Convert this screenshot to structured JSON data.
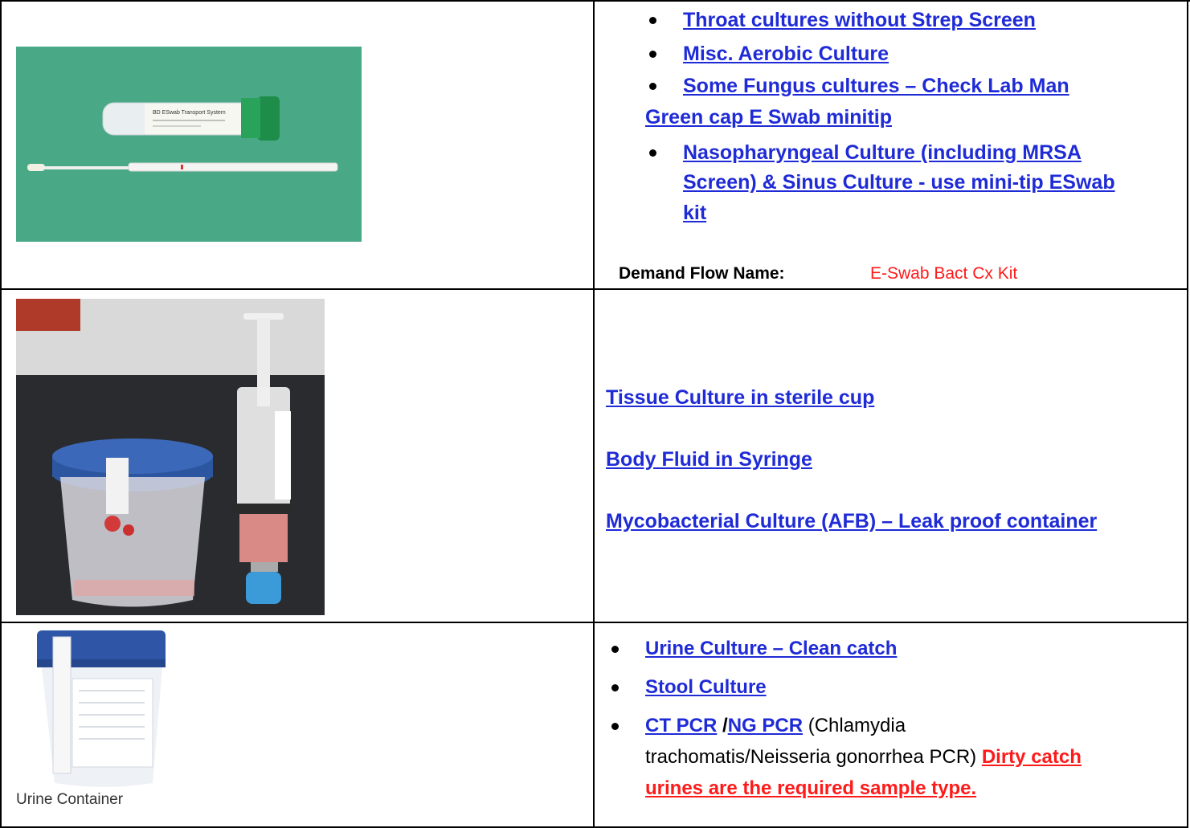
{
  "row1": {
    "links": [
      "Throat cultures without Strep Screen",
      "Misc. Aerobic Culture",
      "Some Fungus cultures – Check Lab Man",
      "Green cap E Swab minitip",
      "Nasopharyngeal Culture (including MRSA",
      "Screen) & Sinus Culture - use mini-tip ESwab",
      "kit"
    ],
    "demand_flow_label": "Demand Flow Name:",
    "demand_flow_value": "E-Swab Bact Cx Kit",
    "photo_tube_label": "BD ESwab Transport System"
  },
  "row2": {
    "links": [
      "Tissue Culture in sterile cup",
      "Body Fluid in Syringe",
      "Mycobacterial Culture (AFB) – Leak proof container"
    ]
  },
  "row3": {
    "caption": "Urine Container",
    "links": [
      "Urine Culture – Clean catch",
      "Stool Culture"
    ],
    "ct_pcr": "CT PCR",
    "slash": "/",
    "ng_pcr": "NG PCR",
    "pcr_desc_1": "(Chlamydia",
    "pcr_desc_2": "trachomatis/Neisseria gonorrhea PCR)",
    "dirty_1": "Dirty catch",
    "dirty_2": "urines are the required sample type."
  },
  "colors": {
    "link": "#1f2bd6",
    "alert": "#ff1a1a",
    "swab_background": "#4fae8a"
  }
}
